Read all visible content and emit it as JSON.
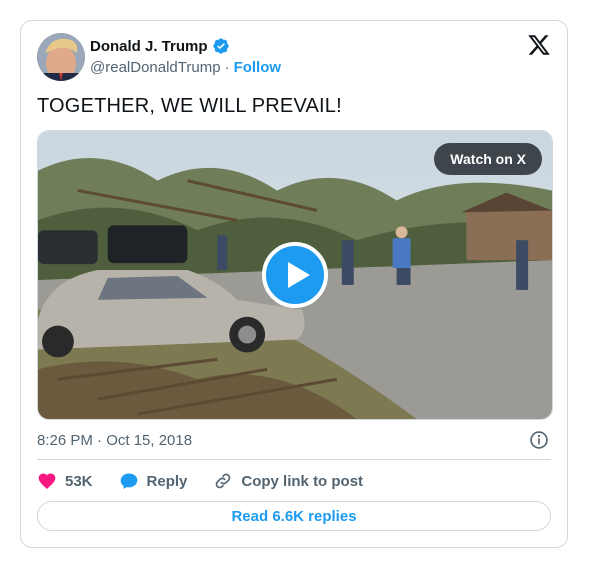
{
  "author": {
    "name": "Donald J. Trump",
    "handle": "@realDonaldTrump",
    "separator": "·",
    "follow_label": "Follow",
    "verified_color": "#1d9bf0"
  },
  "tweet": {
    "text": "TOGETHER, WE WILL PREVAIL!",
    "timestamp": "8:26 PM · Oct 15, 2018"
  },
  "media": {
    "watch_label": "Watch on X",
    "play_icon": "play-icon"
  },
  "actions": {
    "likes_count": "53K",
    "reply_label": "Reply",
    "copy_link_label": "Copy link to post"
  },
  "footer": {
    "read_replies_label": "Read 6.6K replies"
  },
  "colors": {
    "accent": "#1d9bf0",
    "heart": "#f91880",
    "text_secondary": "#536471",
    "border": "#cfd9de"
  }
}
